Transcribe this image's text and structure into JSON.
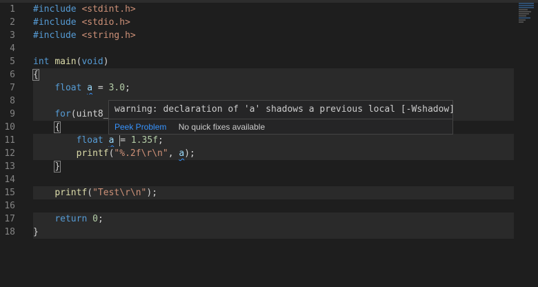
{
  "line_numbers": [
    "1",
    "2",
    "3",
    "4",
    "5",
    "6",
    "7",
    "8",
    "9",
    "10",
    "11",
    "12",
    "13",
    "14",
    "15",
    "16",
    "17",
    "18"
  ],
  "code": {
    "l1_directive": "#include",
    "l1_header": "<stdint.h>",
    "l2_directive": "#include",
    "l2_header": "<stdio.h>",
    "l3_directive": "#include",
    "l3_header": "<string.h>",
    "l5_type": "int",
    "l5_func": "main",
    "l5_open": "(",
    "l5_void": "void",
    "l5_close": ")",
    "l6_brace": "{",
    "l7_type": "float",
    "l7_var": "a",
    "l7_assign": " = ",
    "l7_value": "3.0",
    "l7_semi": ";",
    "l9_kw": "for",
    "l9_rest": "(uint8_",
    "l10_brace": "{",
    "l11_type": "float",
    "l11_var": "a",
    "l11_assign": "= ",
    "l11_value": "1.35f",
    "l11_semi": ";",
    "l12_func": "printf",
    "l12_open": "(",
    "l12_string": "\"%.2f\\r\\n\"",
    "l12_comma": ", ",
    "l12_var": "a",
    "l12_close": ");",
    "l13_brace": "}",
    "l15_func": "printf",
    "l15_open": "(",
    "l15_string": "\"Test\\r\\n\"",
    "l15_close": ");",
    "l17_kw": "return",
    "l17_value": "0",
    "l17_semi": ";",
    "l18_brace": "}"
  },
  "hover": {
    "message": "warning: declaration of 'a' shadows a previous local [-Wshadow]",
    "peek_label": "Peek Problem",
    "no_fixes_label": "No quick fixes available"
  },
  "colors": {
    "background": "#1e1e1e",
    "keyword": "#569cd6",
    "string": "#ce9178",
    "number": "#b5cea8",
    "function": "#dcdcaa",
    "variable": "#9cdcfe",
    "warning_squiggle": "#3794ff",
    "link": "#3794ff"
  }
}
